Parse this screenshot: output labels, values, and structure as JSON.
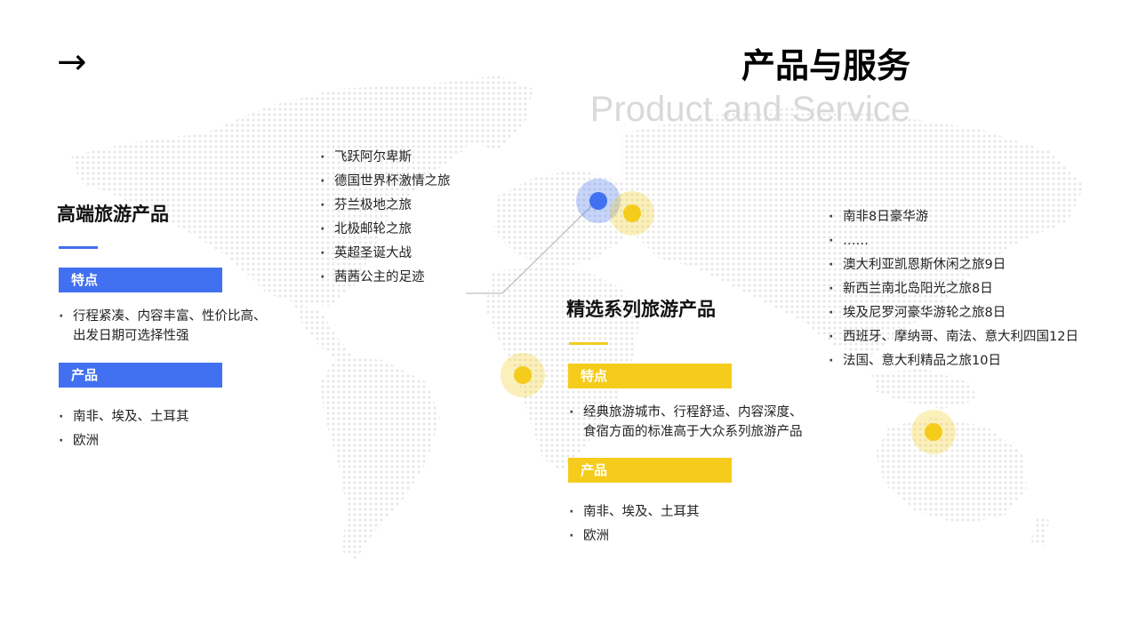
{
  "header": {
    "arrow_glyph": "→",
    "title": "产品与服务",
    "subtitle": "Product and Service"
  },
  "left_section": {
    "title": "高端旅游产品",
    "features_label": "特点",
    "features": [
      "行程紧凑、内容丰富、性价比高、",
      "出发日期可选择性强"
    ],
    "products_label": "产品",
    "products": [
      "南非、埃及、土耳其",
      "欧洲"
    ]
  },
  "top_list": [
    "飞跃阿尔卑斯",
    "德国世界杯激情之旅",
    "芬兰极地之旅",
    "北极邮轮之旅",
    "英超圣诞大战",
    "茜茜公主的足迹"
  ],
  "middle_section": {
    "title": "精选系列旅游产品",
    "features_label": "特点",
    "features": [
      "经典旅游城市、行程舒适、内容深度、",
      "食宿方面的标准高于大众系列旅游产品"
    ],
    "products_label": "产品",
    "products": [
      "南非、埃及、土耳其",
      "欧洲"
    ]
  },
  "right_list": [
    "南非8日豪华游",
    "……",
    "澳大利亚凯恩斯休闲之旅9日",
    "新西兰南北岛阳光之旅8日",
    "埃及尼罗河豪华游轮之旅8日",
    "西班牙、摩纳哥、南法、意大利四国12日",
    "法国、意大利精品之旅10日"
  ],
  "colors": {
    "accent_blue": "#4170f0",
    "accent_yellow": "#f5cc1c",
    "map_dots": "#e6e6e6",
    "subtitle": "#d9d9d9"
  }
}
